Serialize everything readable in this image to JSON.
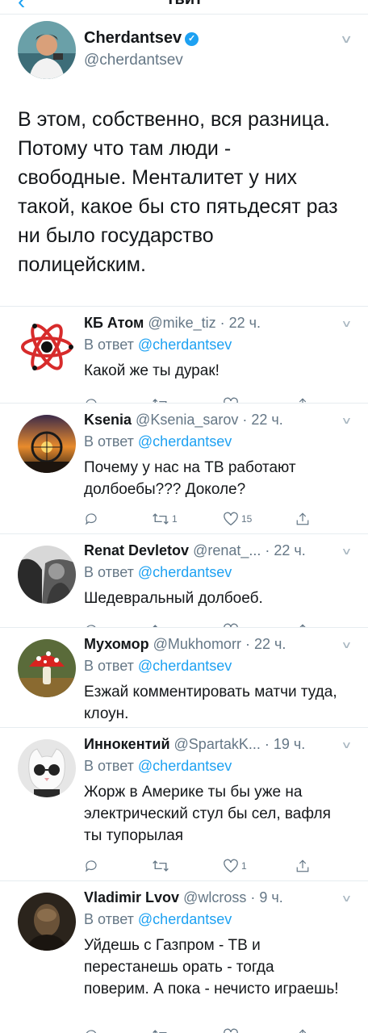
{
  "header": {
    "title": "Твит",
    "back_icon": "chevron-left-icon"
  },
  "main_tweet": {
    "name": "Cherdantsev",
    "handle": "@cherdantsev",
    "text": "В этом, собственно, вся разница. Потому что там люди - свободные. Менталитет у них такой, какое бы сто пятьдесят раз ни было государство полицейским."
  },
  "replies": [
    {
      "name": "КБ Атом",
      "handle": "@mike_tiz",
      "time": "22 ч.",
      "reply_label": "В ответ",
      "mention": "@cherdantsev",
      "text": "Какой же ты дурак!",
      "retweets": "",
      "likes": ""
    },
    {
      "name": "Ksenia",
      "handle": "@Ksenia_sarov",
      "time": "22 ч.",
      "reply_label": "В ответ",
      "mention": "@cherdantsev",
      "text": "Почему у нас на ТВ работают долбоебы??? Доколе?",
      "retweets": "1",
      "likes": "15"
    },
    {
      "name": "Renat Devletov",
      "handle": "@renat_...",
      "time": "22 ч.",
      "reply_label": "В ответ",
      "mention": "@cherdantsev",
      "text": "Шедевральный долбоеб.",
      "retweets": "",
      "likes": ""
    },
    {
      "name": "Мухомор",
      "handle": "@Mukhomorr",
      "time": "22 ч.",
      "reply_label": "В ответ",
      "mention": "@cherdantsev",
      "text": "Езжай комментировать матчи туда, клоун.",
      "retweets": "",
      "likes": ""
    },
    {
      "name": "Иннокентий",
      "handle": "@SpartakK...",
      "time": "19 ч.",
      "reply_label": "В ответ",
      "mention": "@cherdantsev",
      "text": "Жорж в Америке ты бы уже на электрический стул бы сел, вафля ты тупорылая",
      "retweets": "",
      "likes": "1"
    },
    {
      "name": "Vladimir Lvov",
      "handle": "@wlcross",
      "time": "9 ч.",
      "reply_label": "В ответ",
      "mention": "@cherdantsev",
      "text": "Уйдешь с Газпром - ТВ и перестанешь орать - тогда поверим. А пока - нечисто играешь!",
      "retweets": "",
      "likes": ""
    }
  ],
  "colors": {
    "accent": "#1da1f2",
    "text": "#14171a",
    "muted": "#657786",
    "divider": "#e6ecf0"
  }
}
